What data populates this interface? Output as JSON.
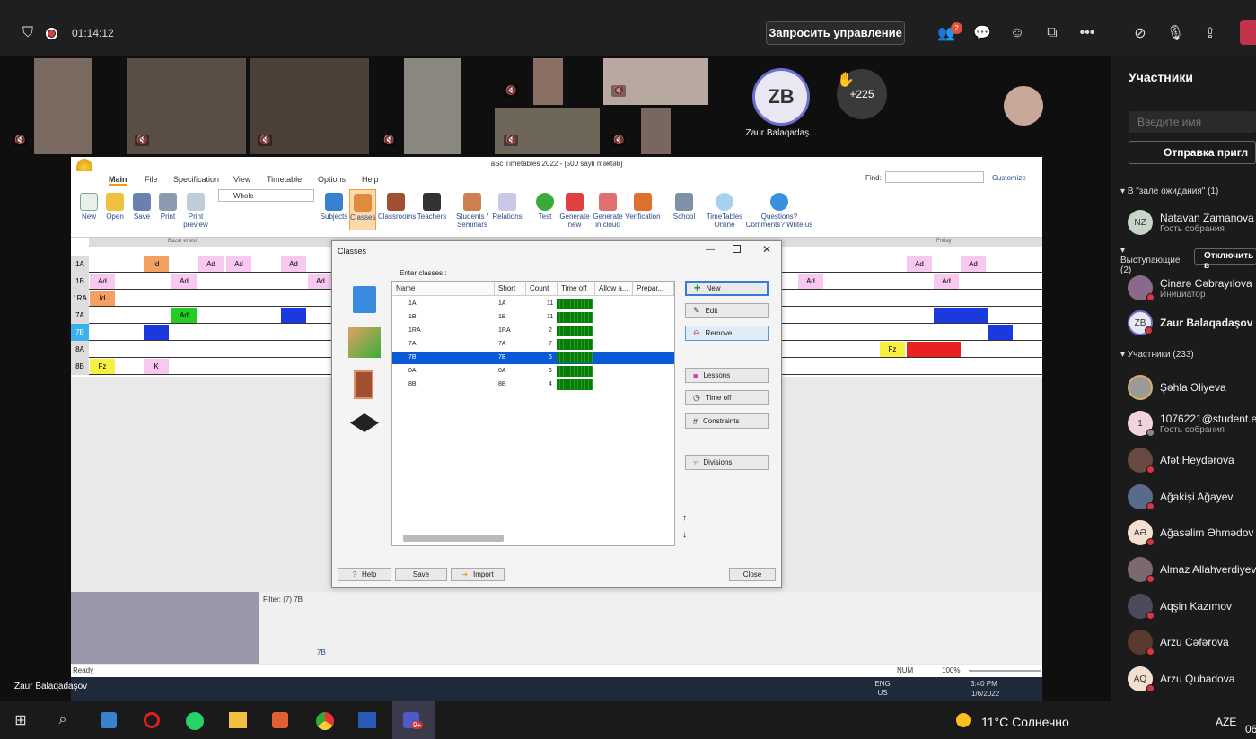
{
  "meeting": {
    "timer": "01:14:12",
    "request_control": "Запросить управление",
    "participants_badge": "2",
    "more_count": "+225",
    "presenter_initials": "ZB",
    "presenter_name": "Zaur Balaqadaş...",
    "sharing_label": "Zaur Balaqadaşov"
  },
  "panel": {
    "title": "Участники",
    "search_placeholder": "Введите имя",
    "invite_label": "Отправка пригл",
    "waiting_header": "В \"зале ожидания\" (1)",
    "speakers_header": "Выступающие (2)",
    "mute_all": "Отключить в",
    "attendees_header": "Участники (233)",
    "waiting": [
      {
        "initials": "NZ",
        "name": "Natavan Zamanova (r",
        "sub": "Гость собрания"
      }
    ],
    "speakers": [
      {
        "name": "Çinarə Cəbrayılova",
        "sub": "Инициатор"
      },
      {
        "initials": "ZB",
        "name": "Zaur Balaqadaşov",
        "sub": ""
      }
    ],
    "attendees": [
      {
        "initials": "",
        "name": "Şəhla Əliyeva",
        "sub": ""
      },
      {
        "initials": "1",
        "name": "1076221@student.edu",
        "sub": "Гость собрания"
      },
      {
        "initials": "",
        "name": "Afət Heydərova",
        "sub": ""
      },
      {
        "initials": "",
        "name": "Ağakişi Ağayev",
        "sub": ""
      },
      {
        "initials": "AƏ",
        "name": "Ağasəlim Əhmədov",
        "sub": ""
      },
      {
        "initials": "",
        "name": "Almaz Allahverdiyeva",
        "sub": ""
      },
      {
        "initials": "",
        "name": "Aqşin Kazımov",
        "sub": ""
      },
      {
        "initials": "",
        "name": "Arzu Cəfərova",
        "sub": ""
      },
      {
        "initials": "AQ",
        "name": "Arzu Qubadova",
        "sub": ""
      }
    ]
  },
  "app": {
    "title": "aSc Timetables 2022 - [500 saylı məktəb]",
    "tabs": [
      "Main",
      "File",
      "Specification",
      "View",
      "Timetable",
      "Options",
      "Help"
    ],
    "find_label": "Find:",
    "customize": "Customize",
    "view_select": "Whole",
    "ribbon": [
      "New",
      "Open",
      "Save",
      "Print",
      "Print preview",
      "Subjects",
      "Classes",
      "Classrooms",
      "Teachers",
      "Students / Seminars",
      "Relations",
      "Test",
      "Generate new",
      "Generate in cloud",
      "Verification",
      "School",
      "TimeTables Online",
      "Questions? Comments? Write us"
    ],
    "day_left": "Bazar ertesi",
    "day_right": "Friday",
    "row_labels": [
      "1A",
      "1B",
      "1RA",
      "7A",
      "7B",
      "8A",
      "8B"
    ],
    "status": "Ready",
    "num": "NUM",
    "zoom": "100%",
    "filter": "Filter: (7) 7B",
    "filter_item": "7B"
  },
  "dialog": {
    "title": "Classes",
    "enter": "Enter classes :",
    "columns": [
      "Name",
      "Short",
      "Count",
      "Time off",
      "Allow a...",
      "Prepar..."
    ],
    "rows": [
      {
        "name": "1A",
        "short": "1A",
        "count": "11"
      },
      {
        "name": "1B",
        "short": "1B",
        "count": "11"
      },
      {
        "name": "1RA",
        "short": "1RA",
        "count": "2"
      },
      {
        "name": "7A",
        "short": "7A",
        "count": "7"
      },
      {
        "name": "7B",
        "short": "7B",
        "count": "5"
      },
      {
        "name": "8A",
        "short": "8A",
        "count": "6"
      },
      {
        "name": "8B",
        "short": "8B",
        "count": "4"
      }
    ],
    "selected_row": 4,
    "buttons": [
      "New",
      "Edit",
      "Remove",
      "Lessons",
      "Time off",
      "Constraints",
      "Divisions"
    ],
    "bottom": [
      "Help",
      "Save",
      "Import",
      "Close"
    ]
  },
  "innertaskbar": {
    "lang": "ENG US",
    "time": "3:40 PM",
    "date": "1/6/2022"
  },
  "taskbar": {
    "weather": "11°C Солнечно",
    "lang": "AZE",
    "teams_badge": "9+",
    "clock": "06"
  }
}
